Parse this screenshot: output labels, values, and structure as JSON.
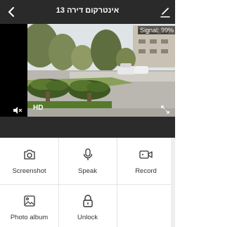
{
  "header": {
    "title": "אינטרקום דירה 13"
  },
  "video": {
    "signal_text": "Signal: 99%",
    "quality_label": "HD"
  },
  "controls": [
    {
      "label": "Screenshot",
      "icon": "camera-icon"
    },
    {
      "label": "Speak",
      "icon": "microphone-icon"
    },
    {
      "label": "Record",
      "icon": "video-record-icon"
    },
    {
      "label": "Photo album",
      "icon": "image-icon"
    },
    {
      "label": "Unlock",
      "icon": "unlock-icon"
    }
  ],
  "colors": {
    "header_bg": "#2a2a2a",
    "video_bg": "#000000",
    "spacer_bg": "#2b2b2b",
    "grid_bg": "#ffffff",
    "icon_color": "#333333"
  }
}
